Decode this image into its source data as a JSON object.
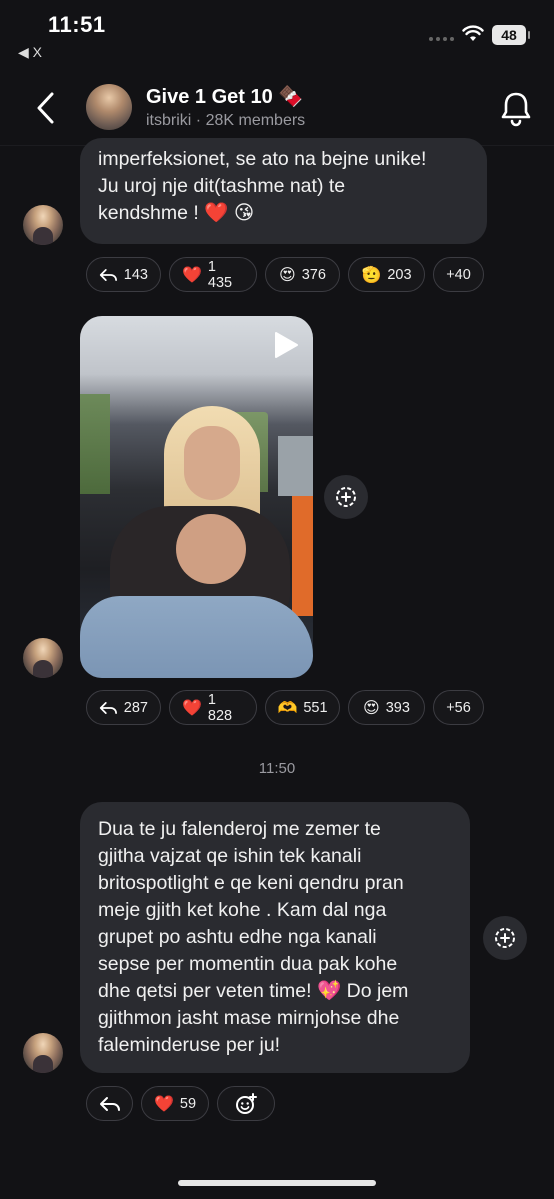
{
  "status_bar": {
    "time": "11:51",
    "back_app": "◀ X",
    "battery": "48"
  },
  "header": {
    "title": "Give 1 Get 10 🍫",
    "channel": "itsbriki",
    "members": "· 28K members"
  },
  "messages": [
    {
      "text": "imperfeksionet, se ato na bejne unike!\nJu uroj nje dit(tashme nat)  te\nkendshme ! ❤️ 😘",
      "reactions": [
        {
          "kind": "reply",
          "count": "143"
        },
        {
          "kind": "emoji",
          "emoji": "❤️",
          "count": "1 435"
        },
        {
          "kind": "emoji",
          "emoji": "😍",
          "count": "376"
        },
        {
          "kind": "emoji",
          "emoji": "🫡",
          "count": "203"
        },
        {
          "kind": "more",
          "count": "+40"
        }
      ]
    },
    {
      "type": "video",
      "reactions": [
        {
          "kind": "reply",
          "count": "287"
        },
        {
          "kind": "emoji",
          "emoji": "❤️",
          "count": "1 828"
        },
        {
          "kind": "emoji",
          "emoji": "🫶",
          "count": "551"
        },
        {
          "kind": "emoji",
          "emoji": "😍",
          "count": "393"
        },
        {
          "kind": "more",
          "count": "+56"
        }
      ]
    },
    {
      "text": "Dua te ju falenderoj me zemer te\ngjitha vajzat qe ishin tek kanali\nbritospotlight e qe keni qendru pran\nmeje gjith ket kohe . Kam dal nga\ngrupet po ashtu edhe nga kanali\nsepse per momentin dua pak kohe\ndhe qetsi per veten time! 💖 Do jem\ngjithmon jasht mase mirnjohse dhe\nfaleminderuse per ju!",
      "reactions": [
        {
          "kind": "reply",
          "count": ""
        },
        {
          "kind": "emoji",
          "emoji": "❤️",
          "count": "59"
        },
        {
          "kind": "add-reaction",
          "count": ""
        }
      ]
    }
  ],
  "date_separator": "11:50",
  "colors": {
    "background": "#121215",
    "bubble": "#2a2b30",
    "chip_border": "#3c3c42",
    "heart": "#e0312e"
  }
}
